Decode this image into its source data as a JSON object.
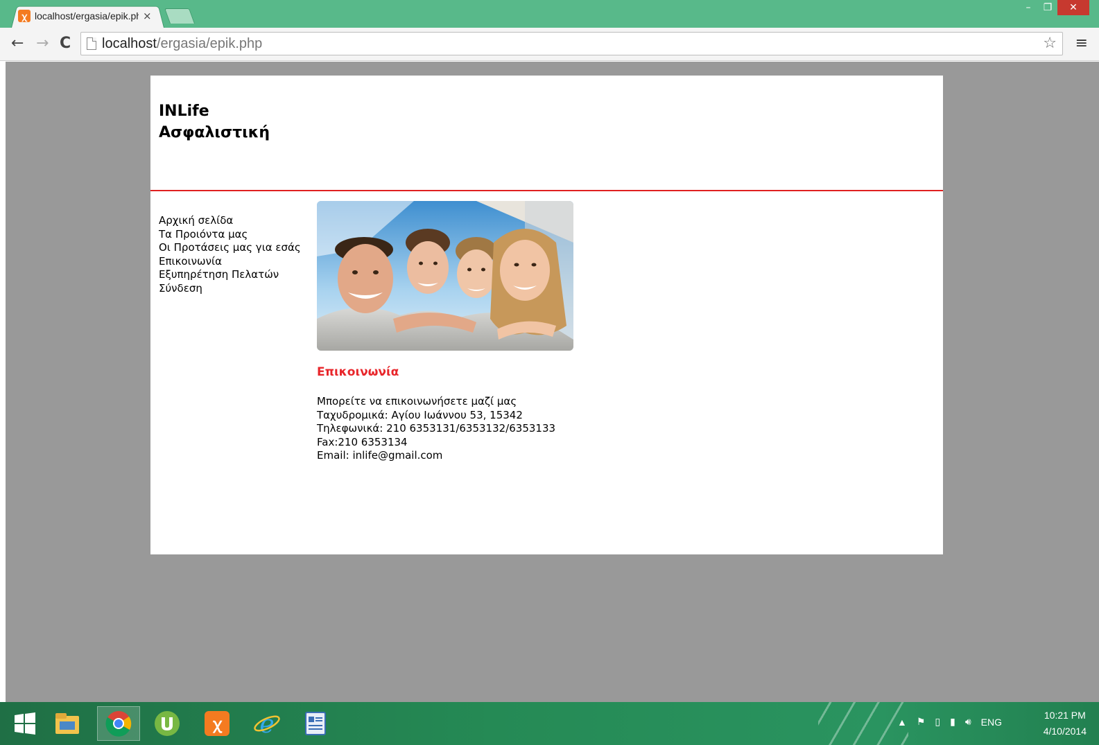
{
  "browser": {
    "tab_title": "localhost/ergasia/epik.php",
    "tab_close": "×",
    "favicon_label": "ꭓ",
    "url_host": "localhost",
    "url_path": "/ergasia/epik.php",
    "nav": {
      "back": "←",
      "forward": "→",
      "reload": "C"
    },
    "window": {
      "minimize": "–",
      "restore": "❐",
      "close": "✕"
    },
    "star": "☆",
    "menu": "≡"
  },
  "site": {
    "title_line1": "INLife",
    "title_line2": "Ασφαλιστική",
    "accent_color": "#e8262b"
  },
  "sidebar": {
    "items": [
      {
        "label": "Αρχική σελίδα"
      },
      {
        "label": "Τα Προιόντα μας"
      },
      {
        "label": "Οι Προτάσεις μας για εσάς"
      },
      {
        "label": "Επικοινωνία"
      },
      {
        "label": "Εξυπηρέτηση Πελατών"
      },
      {
        "label": "Σύνδεση"
      }
    ]
  },
  "main": {
    "image_icon": "family-photo",
    "section_title": "Επικοινωνία",
    "contact_lines": [
      "Μπορείτε να επικοινωνήσετε μαζί μας",
      "Ταχυδρομικά: Αγίου Ιωάννου 53, 15342",
      "Τηλεφωνικά: 210 6353131/6353132/6353133",
      "Fax:210 6353134",
      "Email: inlife@gmail.com"
    ]
  },
  "taskbar": {
    "apps": [
      "windows-start-icon",
      "file-explorer-icon",
      "chrome-icon",
      "utorrent-icon",
      "xampp-icon",
      "internet-explorer-icon",
      "notes-icon"
    ],
    "language": "ENG",
    "time": "10:21 PM",
    "date": "4/10/2014"
  }
}
